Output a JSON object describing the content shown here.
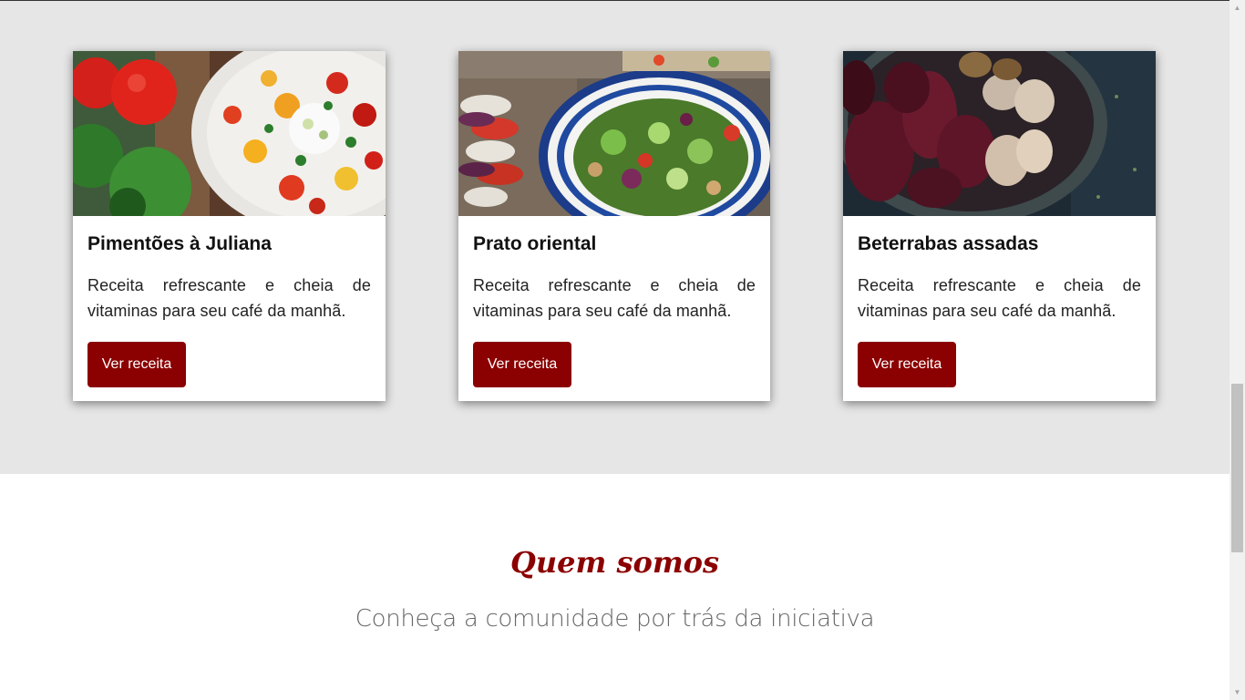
{
  "cards": [
    {
      "title": "Pimentões à Juliana",
      "description": "Receita refrescante e cheia de vitaminas para seu café da manhã.",
      "button_label": "Ver receita"
    },
    {
      "title": "Prato oriental",
      "description": "Receita refrescante e cheia de vitaminas para seu café da manhã.",
      "button_label": "Ver receita"
    },
    {
      "title": "Beterrabas assadas",
      "description": "Receita refrescante e cheia de vitaminas para seu café da manhã.",
      "button_label": "Ver receita"
    }
  ],
  "about": {
    "title": "Quem somos",
    "subtitle": "Conheça a comunidade por trás da iniciativa"
  },
  "colors": {
    "accent": "#8b0000",
    "section_bg": "#e6e6e6"
  },
  "icons": {
    "scroll_up": "triangle-up-icon",
    "scroll_down": "triangle-down-icon"
  }
}
